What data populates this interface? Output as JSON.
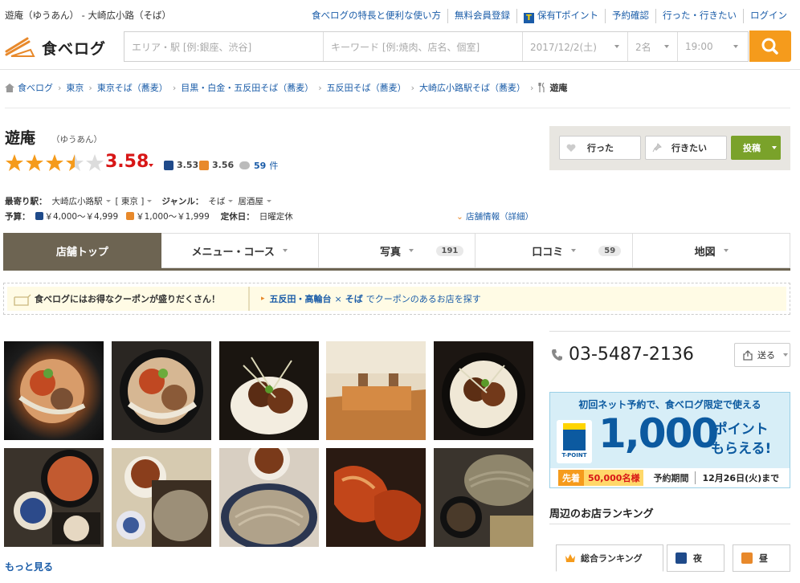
{
  "header": {
    "site_title": "遊庵（ゆうあん） - 大崎広小路（そば）",
    "links": [
      "食べログの特長と便利な使い方",
      "無料会員登録",
      "保有Tポイント",
      "予約確認",
      "行った・行きたい",
      "ログイン"
    ],
    "tpoint_icon_letter": "T"
  },
  "search": {
    "logo_text": "食べログ",
    "area_placeholder": "エリア・駅 [例:銀座、渋谷]",
    "keyword_placeholder": "キーワード [例:焼肉、店名、個室]",
    "date": "2017/12/2(土)",
    "people": "2名",
    "time": "19:00",
    "button_icon": "search-icon"
  },
  "breadcrumb": {
    "items": [
      "食べログ",
      "東京",
      "東京そば（蕎麦）",
      "目黒・白金・五反田そば（蕎麦）",
      "五反田そば（蕎麦）",
      "大崎広小路駅そば（蕎麦）"
    ],
    "current": "遊庵"
  },
  "shop": {
    "name": "遊庵",
    "kana": "（ゆうあん）",
    "rating": 3.58,
    "rating_text": "3.58",
    "night_score": "3.53",
    "day_score": "3.56",
    "review_count": "59",
    "review_unit": "件",
    "station_label": "最寄り駅：",
    "station": "大崎広小路駅",
    "area": "[ 東京 ]",
    "genre_label": "ジャンル：",
    "genre1": "そば",
    "genre2": "居酒屋",
    "budget_label": "予算：",
    "budget_night": "￥4,000～￥4,999",
    "budget_day": "￥1,000～￥1,999",
    "holiday_label": "定休日：",
    "holiday": "日曜定休",
    "detail_link": "店舗情報（詳細）"
  },
  "actions": {
    "went": "行った",
    "want": "行きたい",
    "post": "投稿"
  },
  "tabs": [
    {
      "label": "店舗トップ",
      "count": "",
      "dropdown": false
    },
    {
      "label": "メニュー・コース",
      "count": "",
      "dropdown": true
    },
    {
      "label": "写真",
      "count": "191",
      "dropdown": true
    },
    {
      "label": "口コミ",
      "count": "59",
      "dropdown": true
    },
    {
      "label": "地図",
      "count": "",
      "dropdown": true
    }
  ],
  "coupon": {
    "left_text": "食べログにはお得なクーポンが盛りだくさん！",
    "area_link": "五反田・高輪台",
    "times": "×",
    "genre_link": "そば",
    "suffix": "でクーポンのあるお店を探す"
  },
  "photos": {
    "more_label": "もっと見る"
  },
  "sidebar": {
    "phone": "03-5487-2136",
    "share_label": "送る",
    "banner": {
      "top_text": "初回ネット予約で、食べログ限定で使える",
      "amount": "1,000",
      "points_line1": "ポイント",
      "points_line2": "もらえる!",
      "logo_label": "T-POINT",
      "first_badge": "先着",
      "count": "50,000名様",
      "period_label": "予約期間",
      "deadline": "12月26日(火)まで"
    },
    "ranking_title": "周辺のお店ランキング",
    "ranking_tabs": [
      "総合ランキング",
      "夜",
      "昼"
    ]
  },
  "colors": {
    "link": "#1a5ca8",
    "score_red": "#d81616",
    "star_orange": "#f59b1c",
    "tab_active": "#6d6452",
    "post_green": "#7aa22a"
  }
}
